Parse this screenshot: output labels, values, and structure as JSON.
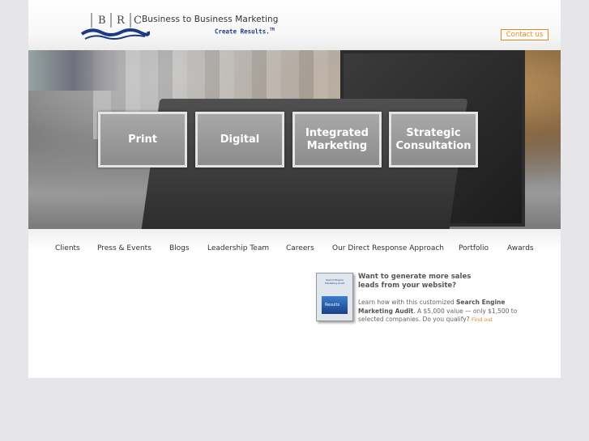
{
  "header": {
    "logo_letters": "BRC",
    "tagline": "Business to Business Marketing",
    "slogan": "Create Results.",
    "slogan_tm": "TM",
    "contact_label": "Contact us"
  },
  "hero": {
    "buttons": [
      {
        "label": "Print"
      },
      {
        "label": "Digital"
      },
      {
        "label": "Integrated Marketing"
      },
      {
        "label": "Strategic Consultation"
      }
    ]
  },
  "nav": {
    "items": [
      "Clients",
      "Press & Events",
      "Blogs",
      "Leadership Team",
      "Careers",
      "Our Direct Response Approach",
      "Portfolio",
      "Awards"
    ]
  },
  "promo": {
    "headline": "Want to generate more sales leads from your website?",
    "body_intro": "Learn how with this customized ",
    "body_bold": "Search Engine Marketing Audit",
    "body_rest": ". A $5,000 value — only $1,500 to selected companies. Do you qualify? ",
    "link_label": "Find out",
    "book_title": "Search Engine Marketing Audit",
    "book_label": "Results"
  },
  "colors": {
    "accent": "#e3891b",
    "brand_blue": "#1b3a86",
    "background": "#e6e6ea"
  }
}
